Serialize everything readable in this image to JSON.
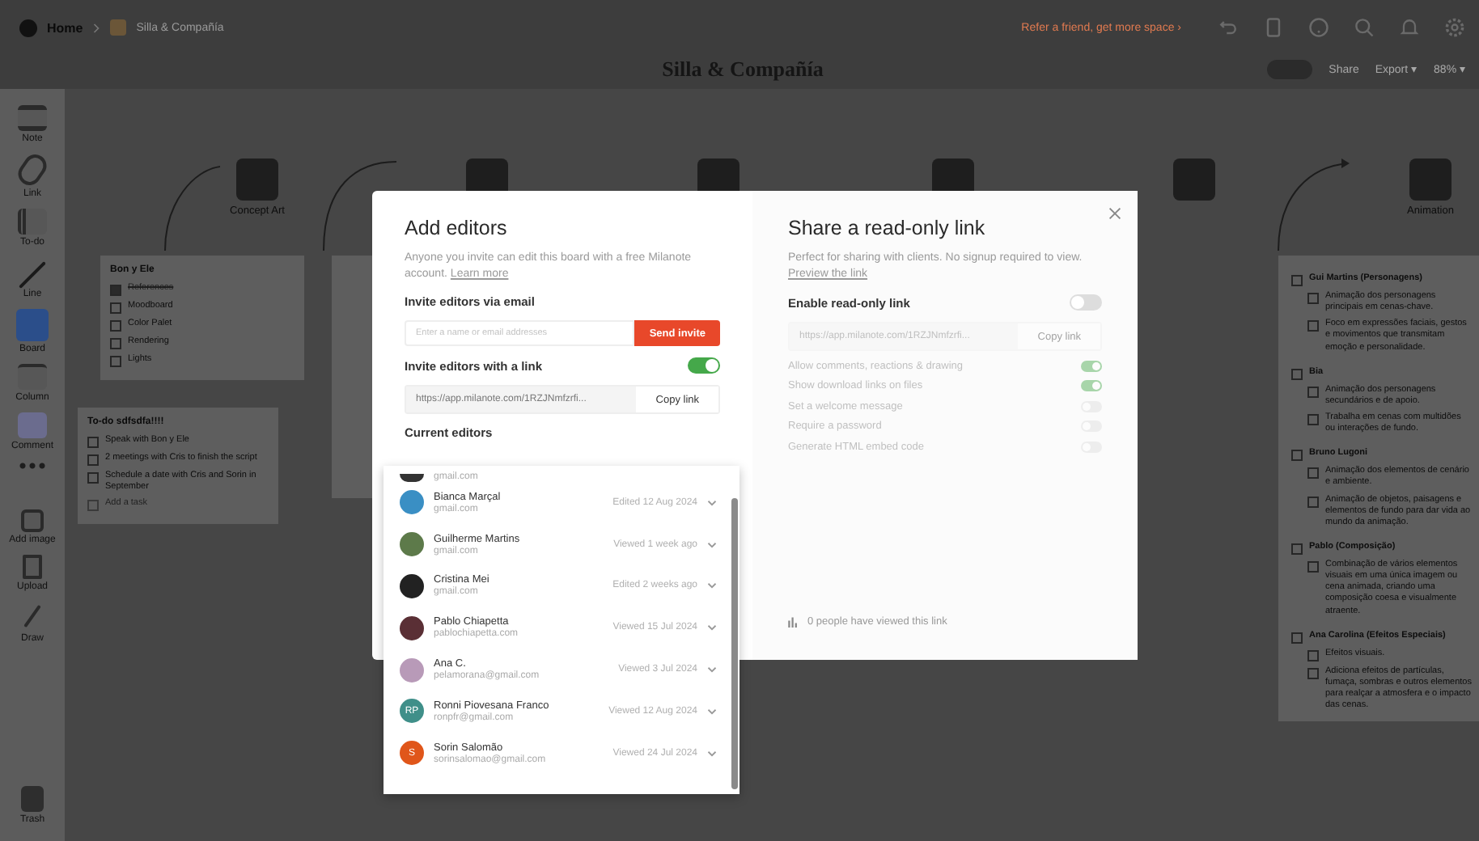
{
  "topbar": {
    "home": "Home",
    "breadcrumb": "Silla & Compañía",
    "refer": "Refer a friend, get more space ›",
    "title": "Silla & Compañía",
    "share": "Share",
    "export": "Export ▾",
    "zoom": "88% ▾"
  },
  "toolbar": {
    "tools": [
      {
        "label": "Note"
      },
      {
        "label": "Link"
      },
      {
        "label": "To-do"
      },
      {
        "label": "Line"
      },
      {
        "label": "Board"
      },
      {
        "label": "Column"
      },
      {
        "label": "Comment"
      },
      {
        "label": "Add image"
      },
      {
        "label": "Upload"
      },
      {
        "label": "Draw"
      }
    ],
    "trash": "Trash"
  },
  "board": {
    "nodes": [
      {
        "title": "Concept Art"
      },
      {
        "title": "Animation"
      }
    ],
    "cards": [
      {
        "title": "Bon y Ele",
        "items": [
          {
            "text": "References",
            "checked": true
          },
          {
            "text": "Moodboard",
            "checked": false
          },
          {
            "text": "Color Palet",
            "checked": false
          },
          {
            "text": "Rendering",
            "checked": false
          },
          {
            "text": "Lights",
            "checked": false
          }
        ]
      },
      {
        "title": "To-do sdfsdfa!!!!",
        "items": [
          {
            "text": "Speak with Bon y Ele",
            "checked": false
          },
          {
            "text": "2 meetings with Cris to finish the script",
            "checked": false
          },
          {
            "text": "Schedule a date with Cris and Sorin in September",
            "checked": false
          }
        ],
        "add": "Add a task"
      }
    ],
    "animation_card": {
      "groups": [
        {
          "title": "Gui Martins (Personagens)",
          "checked": false,
          "items": [
            {
              "text": "Animação dos personagens principais em cenas-chave.",
              "checked": false
            },
            {
              "text": "Foco em expressões faciais, gestos e movimentos que transmitam emoção e personalidade.",
              "checked": false
            }
          ]
        },
        {
          "title": "Bia",
          "checked": false,
          "items": [
            {
              "text": "Animação dos personagens secundários e de apoio.",
              "checked": false
            },
            {
              "text": "Trabalha em cenas com multidões ou interações de fundo.",
              "checked": false
            }
          ]
        },
        {
          "title": "Bruno Lugoni",
          "checked": false,
          "items": [
            {
              "text": "Animação dos elementos de cenário e ambiente.",
              "checked": false
            },
            {
              "text": "Animação de objetos, paisagens e elementos de fundo para dar vida ao mundo da animação.",
              "checked": false
            }
          ]
        },
        {
          "title": "Pablo (Composição)",
          "checked": false,
          "items": [
            {
              "text": "Combinação de vários elementos visuais em uma única imagem ou cena animada, criando uma composição coesa e visualmente atraente.",
              "checked": false
            }
          ]
        },
        {
          "title": "Ana Carolina (Efeitos Especiais)",
          "checked": false,
          "items": [
            {
              "text": "Efeitos visuais.",
              "checked": false
            },
            {
              "text": "Adiciona efeitos de partículas, fumaça, sombras e outros elementos para realçar a atmosfera e o impacto das cenas.",
              "checked": false
            }
          ]
        }
      ]
    }
  },
  "dialog": {
    "add_editors": {
      "title": "Add editors",
      "description": "Anyone you invite can edit this board with a free Milanote account.",
      "learn_more": "Learn more",
      "email_label": "Invite editors via email",
      "email_placeholder": "Enter a name or email addresses",
      "send": "Send invite",
      "link_label": "Invite editors with a link",
      "link_on": true,
      "link_url": "https://app.milanote.com/1RZJNmfzrfi...",
      "copy": "Copy link",
      "current_label": "Current editors",
      "editors": [
        {
          "email": "gmail.com",
          "color": "#333333"
        },
        {
          "name": "Bianca Marçal",
          "email": "gmail.com",
          "status": "Edited 12 Aug 2024",
          "color": "#3a8fc4"
        },
        {
          "name": "Guilherme Martins",
          "email": "gmail.com",
          "status": "Viewed 1 week ago",
          "color": "#5d7a4a"
        },
        {
          "name": "Cristina Mei",
          "email": "gmail.com",
          "status": "Edited 2 weeks ago",
          "color": "#222222"
        },
        {
          "name": "Pablo Chiapetta",
          "email": "pablochiapetta.com",
          "status": "Viewed 15 Jul 2024",
          "color": "#5a2f35"
        },
        {
          "name": "Ana C.",
          "email": "pelamorana@gmail.com",
          "status": "Viewed 3 Jul 2024",
          "color": "#b89ab8"
        },
        {
          "name": "Ronni Piovesana Franco",
          "email": "ronpfr@gmail.com",
          "status": "Viewed 12 Aug 2024",
          "initials": "RP",
          "color": "#3f8f89"
        },
        {
          "name": "Sorin Salomão",
          "email": "sorinsalomao@gmail.com",
          "status": "Viewed 24 Jul 2024",
          "initials": "S",
          "color": "#e0561a"
        }
      ]
    },
    "read_only": {
      "title": "Share a read-only link",
      "description": "Perfect for sharing with clients. No signup required to view.",
      "preview": "Preview the link",
      "enable_label": "Enable read-only link",
      "enabled": false,
      "link_url": "https://app.milanote.com/1RZJNmfzrfi...",
      "copy": "Copy link",
      "options": [
        {
          "label": "Allow comments, reactions & drawing",
          "on": true
        },
        {
          "label": "Show download links on files",
          "on": true
        },
        {
          "label": "Set a welcome message",
          "on": false
        },
        {
          "label": "Require a password",
          "on": false
        },
        {
          "label": "Generate HTML embed code",
          "on": false
        }
      ],
      "views": "0 people have viewed this link"
    }
  }
}
